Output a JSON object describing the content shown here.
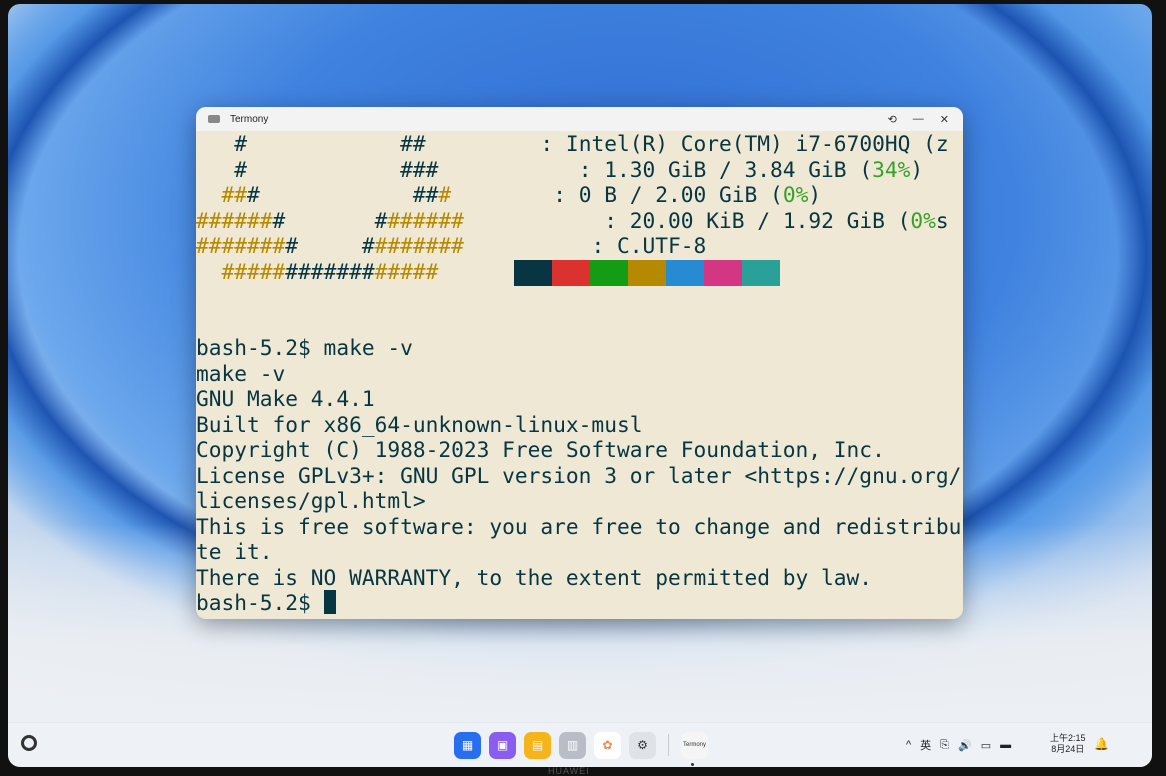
{
  "window": {
    "title": "Termony"
  },
  "controls": {
    "restore": "⟲",
    "minimize": "—",
    "close": "✕"
  },
  "terminal": {
    "neofetch": {
      "cpu": ": Intel(R) Core(TM) i7-6700HQ (z",
      "mem_a": ": 1.30 GiB / 3.84 GiB (",
      "mem_pct": "34%",
      "mem_b": ")",
      "swap_a": ": 0 B / 2.00 GiB (",
      "swap_pct": "0%",
      "swap_b": ")",
      "disk_a": ": 20.00 KiB / 1.92 GiB (",
      "disk_pct": "0%",
      "disk_b": "s",
      "locale": ": C.UTF-8"
    },
    "palette": [
      "#073642",
      "#dc322f",
      "#149c14",
      "#b58900",
      "#268bd2",
      "#d33682",
      "#2aa198"
    ],
    "lines": [
      "bash-5.2$ make -v",
      "make -v",
      "GNU Make 4.4.1",
      "Built for x86_64-unknown-linux-musl",
      "Copyright (C) 1988-2023 Free Software Foundation, Inc.",
      "License GPLv3+: GNU GPL version 3 or later <https://gnu.org/",
      "licenses/gpl.html>",
      "This is free software: you are free to change and redistribu",
      "te it.",
      "There is NO WARRANTY, to the extent permitted by law."
    ],
    "prompt": "bash-5.2$ "
  },
  "taskbar": {
    "dock_icon_names": [
      "app-grid-icon",
      "multitask-icon",
      "files-icon",
      "trash-icon",
      "gallery-icon",
      "settings-icon",
      "termony-icon"
    ],
    "termony_label": "Termony",
    "tray": {
      "chevron": "^",
      "ime": "英",
      "clipboard": "⎘",
      "volume": "🔊",
      "display": "▭",
      "battery": "▬"
    },
    "time": "上午2:15",
    "date": "8月24日"
  },
  "brand": "HUAWEI"
}
